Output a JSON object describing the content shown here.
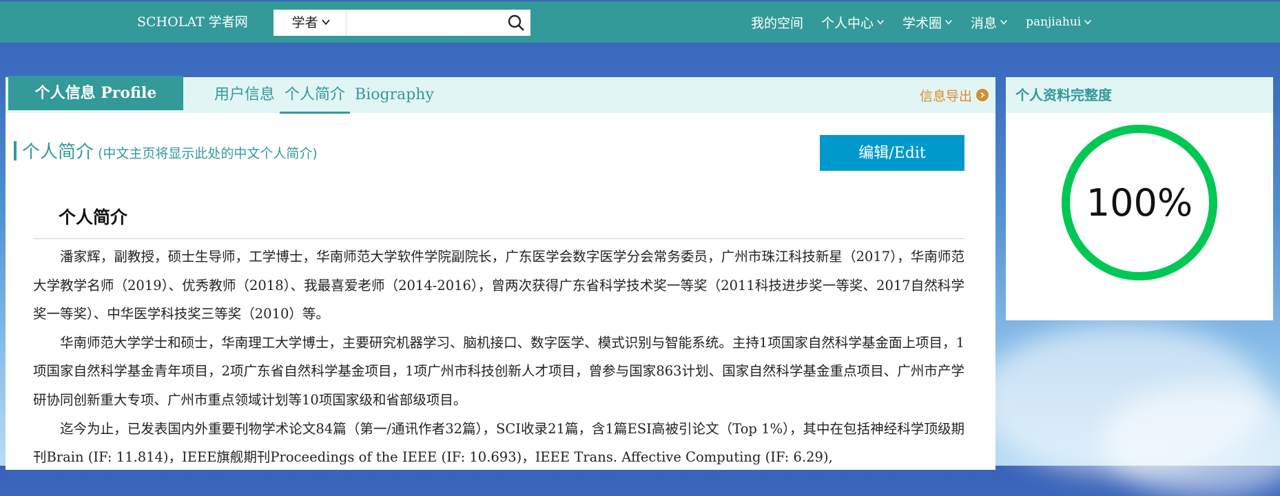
{
  "topnav": {
    "brand": "SCHOLAT 学者网",
    "search": {
      "type_label": "学者",
      "placeholder": ""
    },
    "links": {
      "my_space": "我的空间",
      "personal_center": "个人中心",
      "academic_circle": "学术圈",
      "messages": "消息",
      "user": "panjiahui"
    }
  },
  "profile": {
    "tab_title": "个人信息 Profile",
    "subtabs": {
      "user_info": "用户信息",
      "intro": "个人简介",
      "biography": "Biography"
    },
    "active_subtab": "个人简介",
    "export_label": "信息导出",
    "section_title": "个人简介",
    "section_note": "(中文主页将显示此处的中文个人简介)",
    "edit_label": "编辑/Edit",
    "bio_heading": "个人简介",
    "bio_paragraphs": [
      "潘家辉，副教授，硕士生导师，工学博士，华南师范大学软件学院副院长，广东医学会数字医学分会常务委员，广州市珠江科技新星（2017），华南师范大学教学名师（2019）、优秀教师（2018）、我最喜爱老师（2014-2016），曾两次获得广东省科学技术奖一等奖（2011科技进步奖一等奖、2017自然科学奖一等奖）、中华医学科技奖三等奖（2010）等。",
      "华南师范大学学士和硕士，华南理工大学博士，主要研究机器学习、脑机接口、数字医学、模式识别与智能系统。主持1项国家自然科学基金面上项目，1项国家自然科学基金青年项目，2项广东省自然科学基金项目，1项广州市科技创新人才项目，曾参与国家863计划、国家自然科学基金重点项目、广州市产学研协同创新重大专项、广州市重点领域计划等10项国家级和省部级项目。",
      "迄今为止，已发表国内外重要刊物学术论文84篇（第一/通讯作者32篇），SCI收录21篇，含1篇ESI高被引论文（Top 1%），其中在包括神经科学顶级期刊Brain (IF: 11.814)，IEEE旗舰期刊Proceedings of the IEEE (IF: 10.693)，IEEE Trans. Affective Computing (IF: 6.29),"
    ]
  },
  "completeness": {
    "title": "个人资料完整度",
    "value_text": "100%",
    "value": 1.0,
    "ring_color": "#00c853"
  },
  "colors": {
    "primary": "#339999",
    "tab_bg": "#e2f5f5",
    "edit_button": "#0099cc",
    "export": "#d98a2b"
  }
}
